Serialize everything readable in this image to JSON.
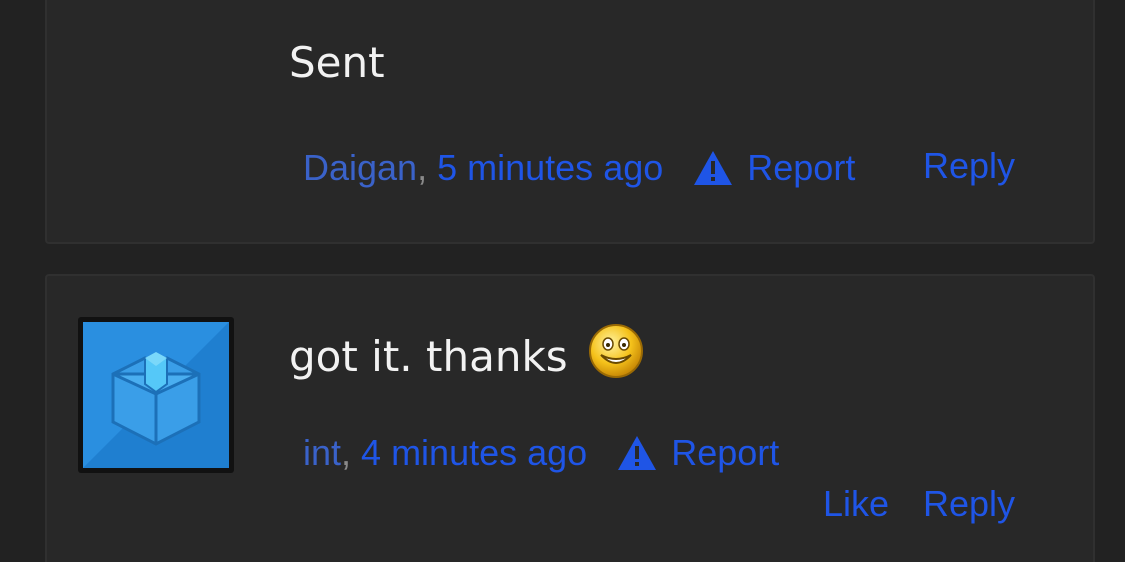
{
  "comments": [
    {
      "message": "Sent",
      "author": "Daigan",
      "separator": ",",
      "time": "5 minutes ago",
      "report_label": "Report",
      "reply_label": "Reply"
    },
    {
      "message": "got it. thanks",
      "emoji": "smiley-icon",
      "author": "int",
      "separator": ",",
      "time": "4 minutes ago",
      "report_label": "Report",
      "like_label": "Like",
      "reply_label": "Reply"
    }
  ],
  "colors": {
    "background": "#222222",
    "card": "#282828",
    "link": "#1f55e6",
    "text": "#f2f2f2"
  }
}
